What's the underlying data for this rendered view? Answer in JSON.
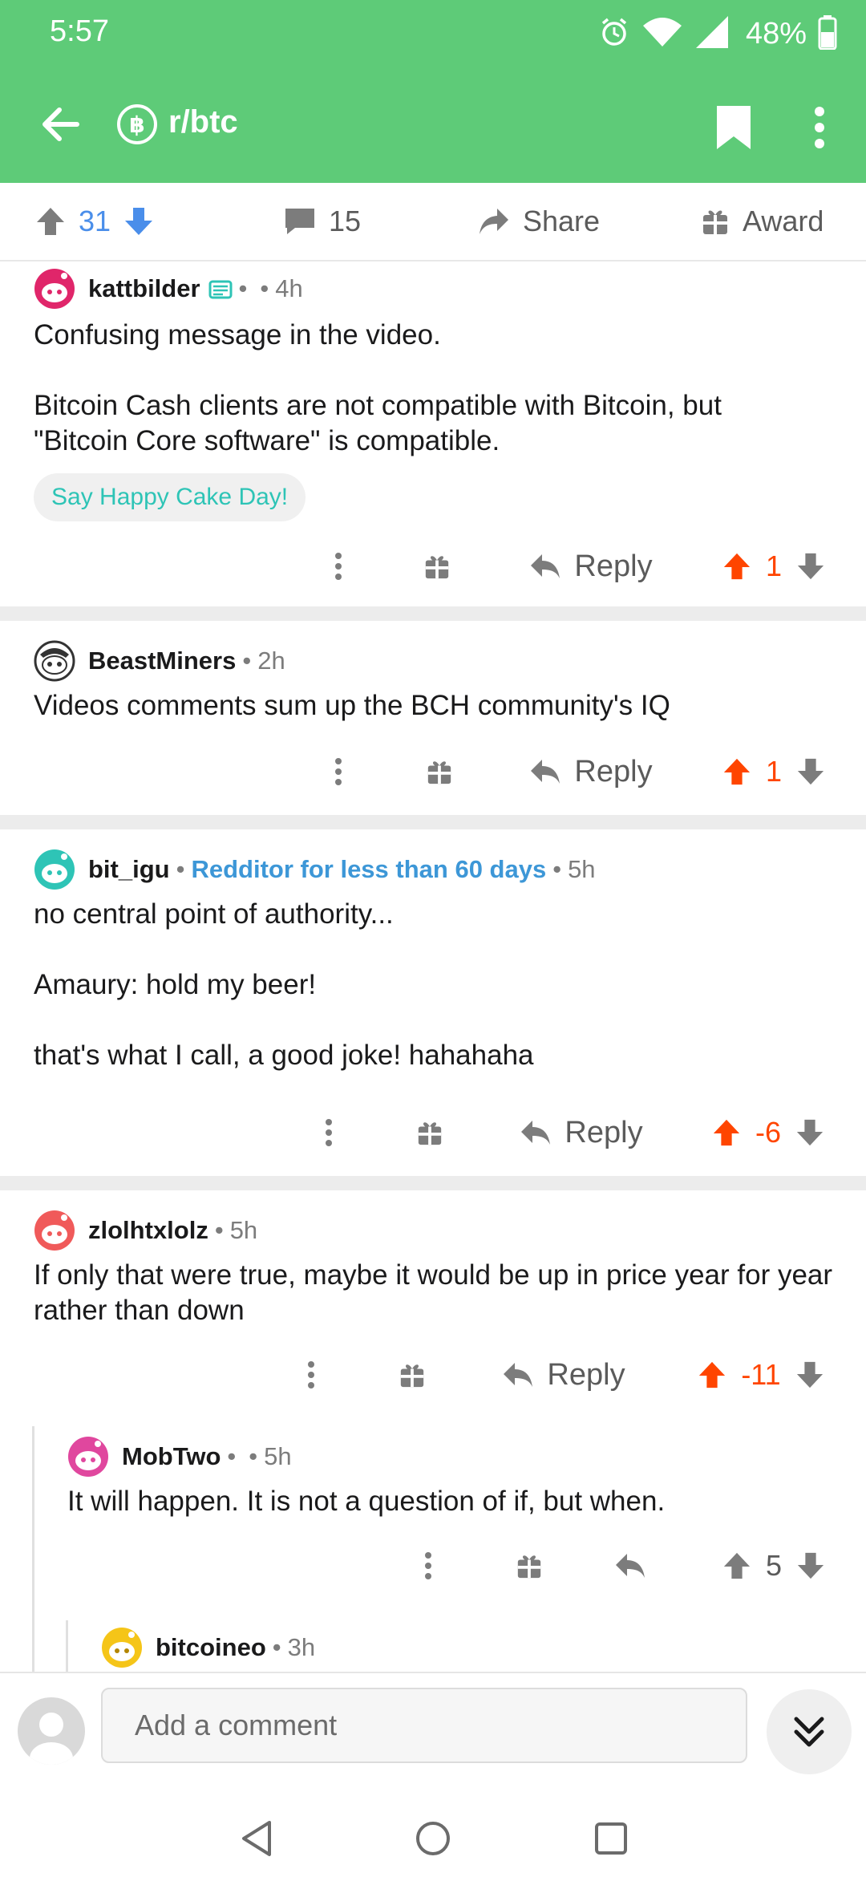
{
  "status_bar": {
    "time": "5:57",
    "battery": "48%"
  },
  "toolbar": {
    "subreddit": "r/btc",
    "sub_icon_glyph": "฿",
    "accent_color": "#5ecb78"
  },
  "post_actions": {
    "upvotes": "31",
    "comments": "15",
    "share_label": "Share",
    "award_label": "Award"
  },
  "comments": [
    {
      "user": "kattbilder",
      "time": "4h",
      "body": "Confusing message in the video.\n\nBitcoin Cash clients are not compatible with Bitcoin, but \"Bitcoin Core software\" is compatible.",
      "cake_day": "Say Happy Cake Day!",
      "reply_label": "Reply",
      "score": "1"
    },
    {
      "user": "BeastMiners",
      "time": "2h",
      "body": "Videos comments sum up the BCH community's IQ",
      "reply_label": "Reply",
      "score": "1"
    },
    {
      "user": "bit_igu",
      "flair": "Redditor for less than 60 days",
      "time": "5h",
      "body": "no central point of authority...\n\nAmaury: hold my beer!\n\nthat's what I call, a good joke! hahahaha",
      "reply_label": "Reply",
      "score": "-6"
    },
    {
      "user": "zlolhtxlolz",
      "time": "5h",
      "body": "If only that were true, maybe it would be up in price year for year rather than down",
      "reply_label": "Reply",
      "score": "-11"
    },
    {
      "user": "MobTwo",
      "time": "5h",
      "body": "It will happen. It is not a question of if, but when.",
      "score": "5"
    },
    {
      "user": "bitcoineo",
      "time": "3h"
    }
  ],
  "comment_bar": {
    "placeholder": "Add a comment"
  },
  "colors": {
    "orange": "#ff4500",
    "blue": "#4a8eea",
    "flair": "#3d97d7",
    "cake": "#2ec4b6"
  }
}
